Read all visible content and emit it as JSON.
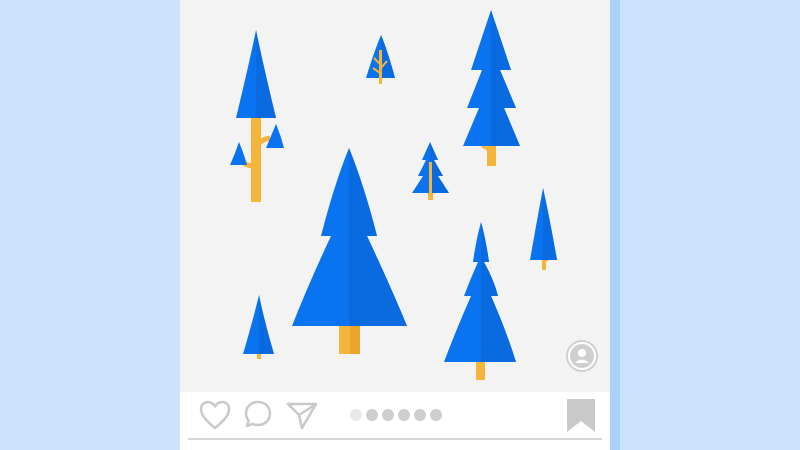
{
  "post": {
    "image": {
      "description_icon": "pine-trees-illustration",
      "tree_color": "#0a74f0",
      "trunk_color": "#f5b43a",
      "background_color": "#f3f3f3"
    },
    "tag_icon": "user-icon",
    "actions": {
      "like_icon": "heart-icon",
      "comment_icon": "comment-icon",
      "share_icon": "send-icon",
      "save_icon": "bookmark-icon"
    },
    "carousel": {
      "count": 6,
      "active_index": 0
    }
  },
  "colors": {
    "page_background": "#cce4fb",
    "phone_edge": "#a9d1fb",
    "icon_gray": "#c9c9c9"
  }
}
